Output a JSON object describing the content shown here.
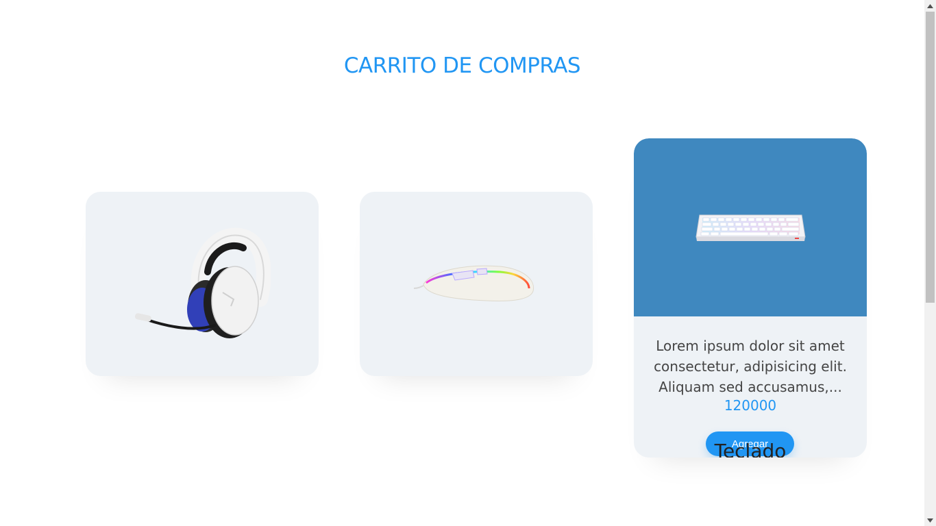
{
  "header": {
    "title": "CARRITO DE COMPRAS"
  },
  "products": [
    {
      "icon": "headset-image",
      "name": "",
      "description": "",
      "price": ""
    },
    {
      "icon": "mouse-image",
      "name": "",
      "description": "",
      "price": ""
    },
    {
      "icon": "keyboard-image",
      "name": "Teclado",
      "description": "Lorem ipsum dolor sit amet consectetur, adipisicing elit. Aliquam sed accusamus,...",
      "price": "120000",
      "button_label": "Agregar"
    }
  ],
  "colors": {
    "accent": "#2196f3",
    "card_bg": "#eef2f6",
    "image_highlight": "#3f88bf"
  }
}
